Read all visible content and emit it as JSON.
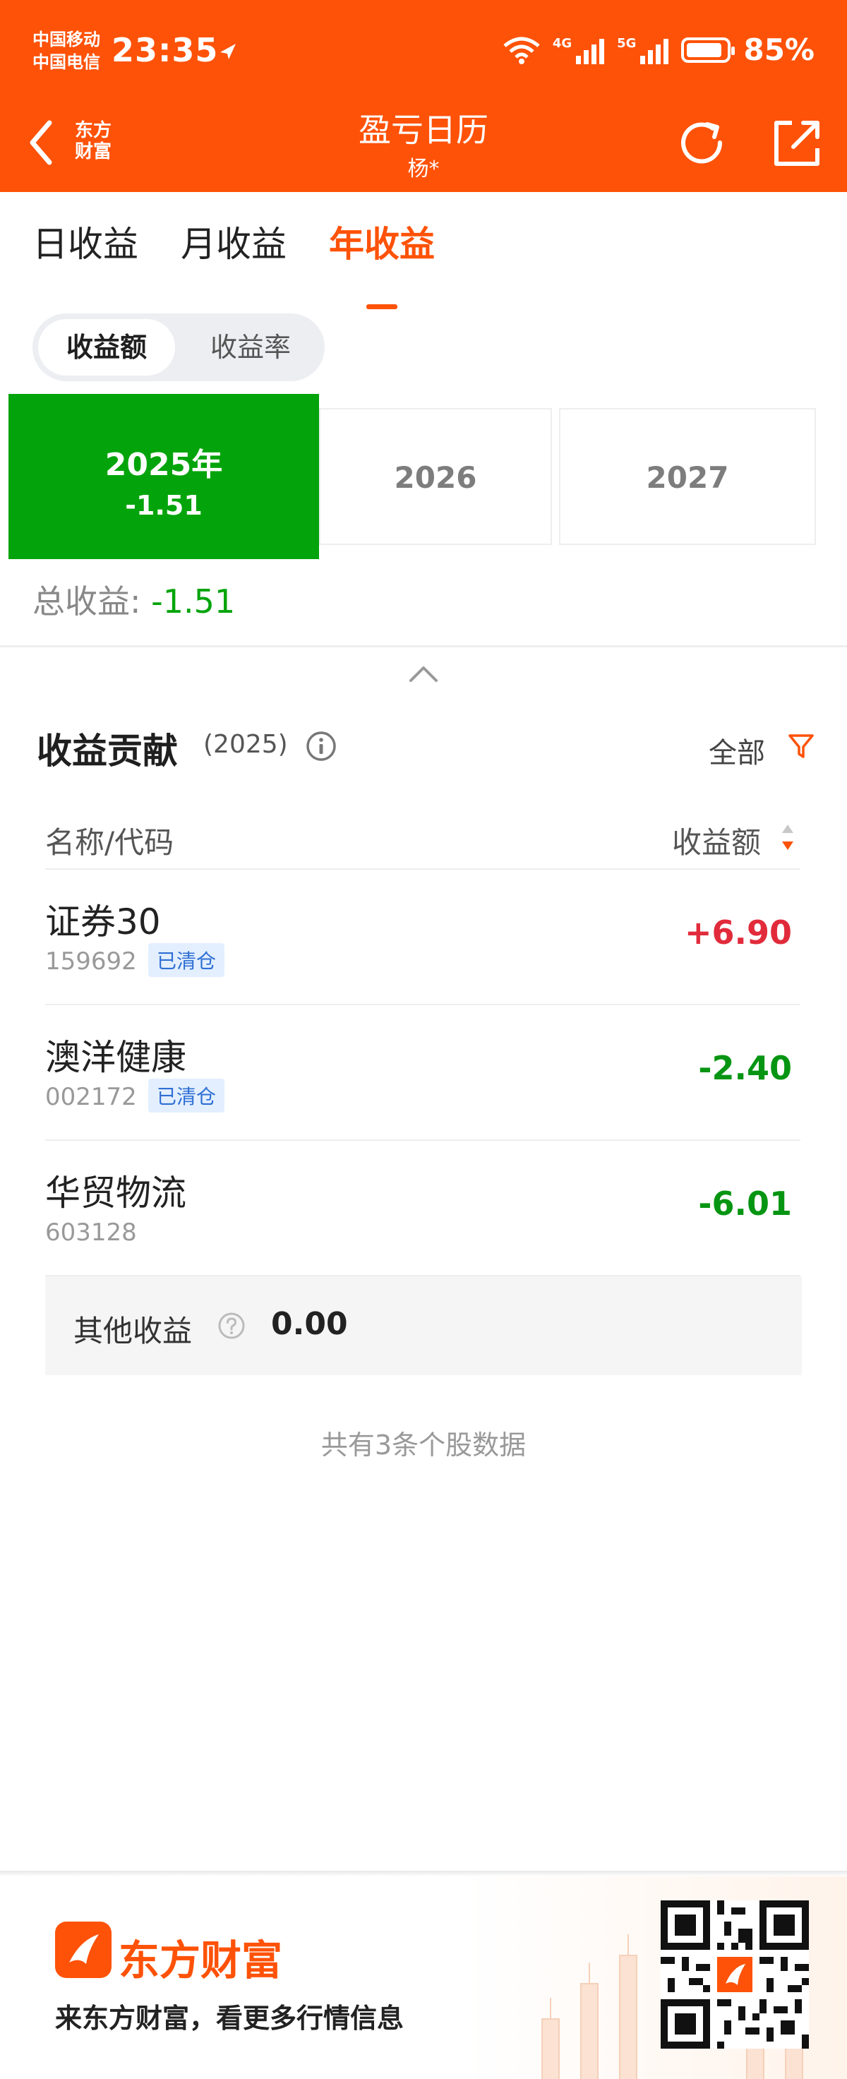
{
  "status_bar": {
    "carrier1": "中国移动",
    "carrier2": "中国电信",
    "time": "23:35",
    "net1": "4G",
    "net2": "5G",
    "battery": "85%"
  },
  "header": {
    "back_app": "东方财富",
    "title": "盈亏日历",
    "subtitle": "杨*"
  },
  "tabs": [
    {
      "label": "日收益",
      "active": false
    },
    {
      "label": "月收益",
      "active": false
    },
    {
      "label": "年收益",
      "active": true
    }
  ],
  "segment": {
    "amount": "收益额",
    "rate": "收益率"
  },
  "years": {
    "selected": {
      "label": "2025年",
      "value": "-1.51"
    },
    "others": [
      "2026",
      "2027"
    ]
  },
  "total": {
    "label": "总收益:",
    "value": "-1.51"
  },
  "contribution": {
    "title": "收益贡献",
    "year": "(2025)",
    "filter": "全部",
    "col_name": "名称/代码",
    "col_value": "收益额",
    "rows": [
      {
        "name": "证券30",
        "code": "159692",
        "tag": "已清仓",
        "value": "+6.90"
      },
      {
        "name": "澳洋健康",
        "code": "002172",
        "tag": "已清仓",
        "value": "-2.40"
      },
      {
        "name": "华贸物流",
        "code": "603128",
        "tag": "",
        "value": "-6.01"
      }
    ],
    "other_label": "其他收益",
    "other_value": "0.00",
    "footnote": "共有3条个股数据"
  },
  "banner": {
    "brand": "东方财富",
    "slogan": "来东方财富，看更多行情信息"
  },
  "colors": {
    "accent": "#fe5208",
    "positive": "#e12b3b",
    "negative": "#069512",
    "selected_year": "#03a40b"
  }
}
